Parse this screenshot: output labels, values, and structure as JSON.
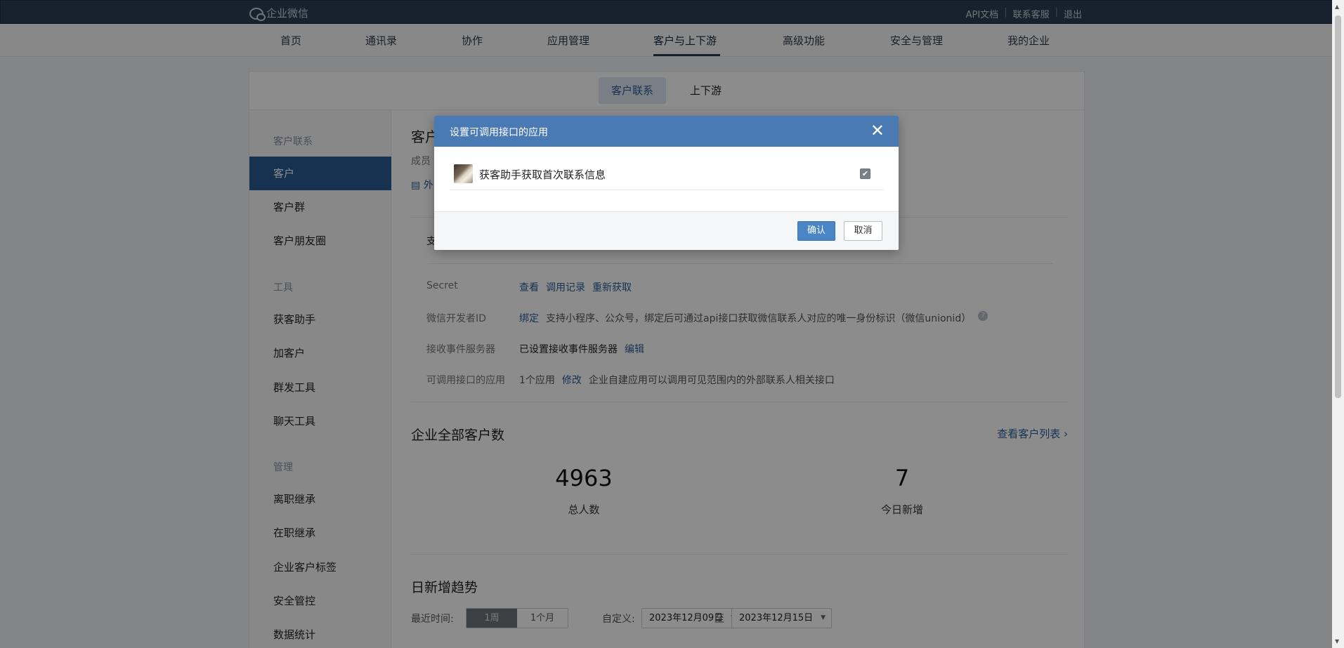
{
  "topbar": {
    "logo": "企业微信",
    "links": [
      "API文档",
      "联系客服",
      "退出"
    ]
  },
  "nav": [
    "首页",
    "通讯录",
    "协作",
    "应用管理",
    "客户与上下游",
    "高级功能",
    "安全与管理",
    "我的企业"
  ],
  "subtabs": {
    "active": "客户联系",
    "other": "上下游"
  },
  "sidebar": {
    "group1": "客户联系",
    "items1": [
      "客户",
      "客户群",
      "客户朋友圈"
    ],
    "group2": "工具",
    "items2": [
      "获客助手",
      "加客户",
      "群发工具",
      "聊天工具"
    ],
    "group3": "管理",
    "items3": [
      "离职继承",
      "在职继承",
      "企业客户标签",
      "安全管控",
      "数据统计"
    ]
  },
  "content": {
    "title": "客户",
    "subtitle": "成员",
    "icon_text": "外",
    "card_label": "支",
    "rows": [
      {
        "label": "Secret",
        "links": [
          "查看",
          "调用记录",
          "重新获取"
        ]
      },
      {
        "label": "微信开发者ID",
        "link": "绑定",
        "desc": "支持小程序、公众号，绑定后可通过api接口获取微信联系人对应的唯一身份标识（微信unionid）"
      },
      {
        "label": "接收事件服务器",
        "value": "已设置接收事件服务器",
        "link": "编辑"
      },
      {
        "label": "可调用接口的应用",
        "value": "1个应用",
        "link": "修改",
        "desc": "企业自建应用可以调用可见范围内的外部联系人相关接口"
      }
    ],
    "total_title": "企业全部客户数",
    "view_list": "查看客户列表 ›",
    "stats": [
      {
        "value": "4963",
        "label": "总人数"
      },
      {
        "value": "7",
        "label": "今日新增"
      }
    ],
    "trend_title": "日新增趋势",
    "recent_label": "最近时间:",
    "seg": [
      "1周",
      "1个月"
    ],
    "custom_label": "自定义:",
    "date_from": "2023年12月09日",
    "to_label": "至",
    "date_to": "2023年12月15日"
  },
  "modal": {
    "title": "设置可调用接口的应用",
    "close": "✕",
    "app_name": "获客助手获取首次联系信息",
    "checked": true,
    "ok": "确认",
    "cancel": "取消"
  }
}
